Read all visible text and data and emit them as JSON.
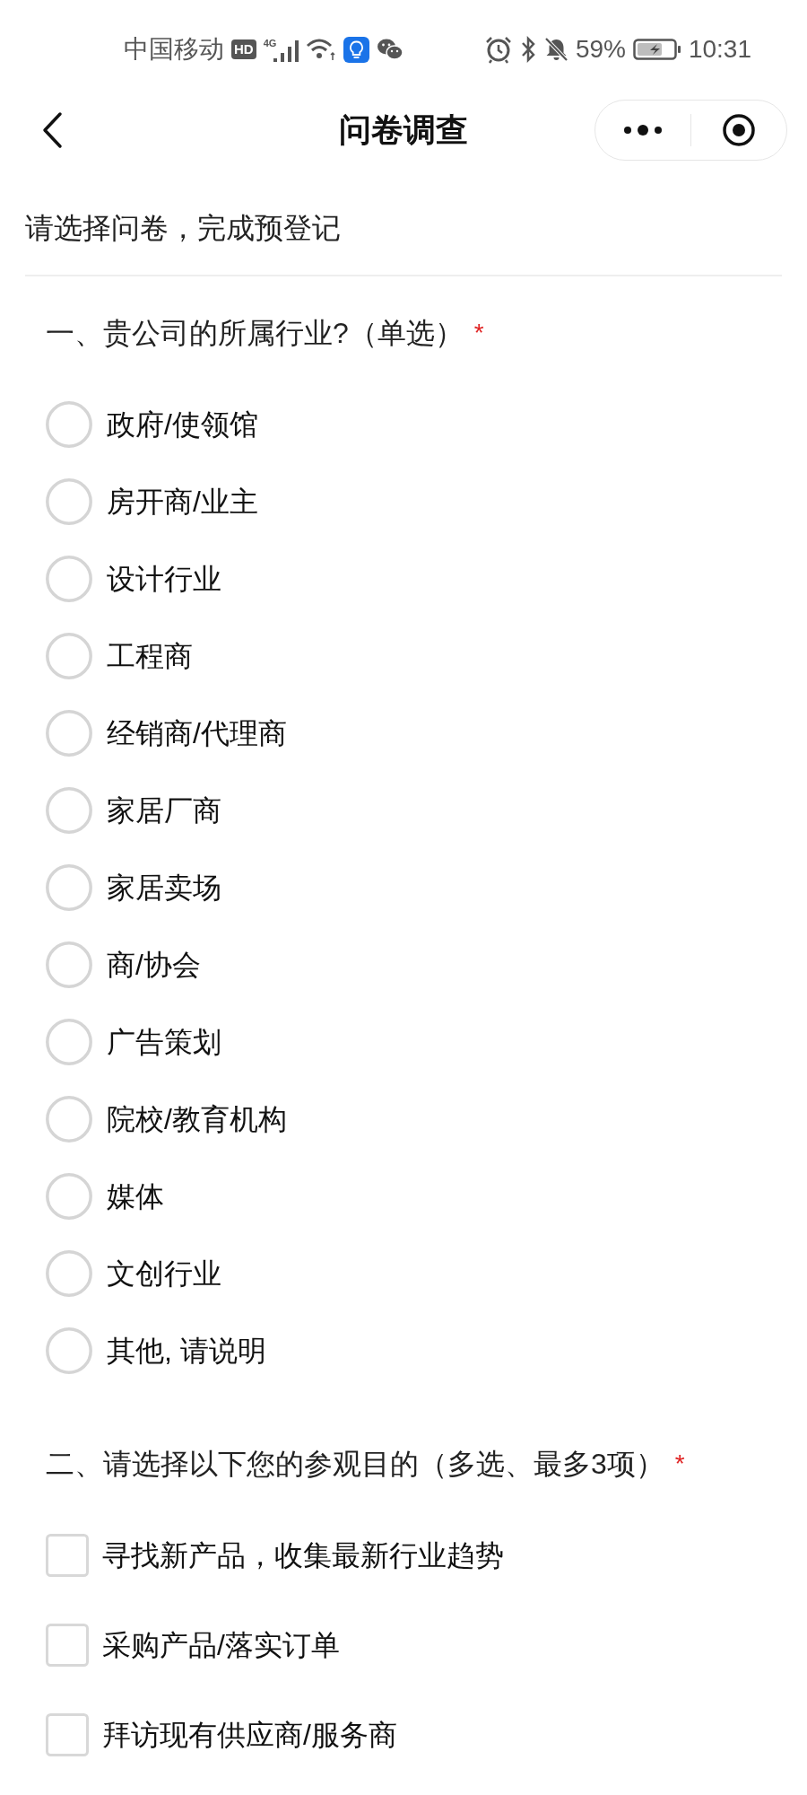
{
  "status_bar": {
    "carrier": "中国移动",
    "hd_badge": "HD",
    "network": "4G",
    "battery_percent": "59%",
    "time": "10:31"
  },
  "header": {
    "title": "问卷调查"
  },
  "intro": "请选择问卷，完成预登记",
  "questions": [
    {
      "kind": "single",
      "title": "一、贵公司的所属行业?（单选）",
      "required_mark": "*",
      "options": [
        {
          "label": "政府/使领馆",
          "selected": false
        },
        {
          "label": "房开商/业主",
          "selected": false
        },
        {
          "label": "设计行业",
          "selected": false
        },
        {
          "label": "工程商",
          "selected": false
        },
        {
          "label": "经销商/代理商",
          "selected": false
        },
        {
          "label": "家居厂商",
          "selected": false
        },
        {
          "label": "家居卖场",
          "selected": false
        },
        {
          "label": "商/协会",
          "selected": false
        },
        {
          "label": "广告策划",
          "selected": false
        },
        {
          "label": "院校/教育机构",
          "selected": false
        },
        {
          "label": "媒体",
          "selected": false
        },
        {
          "label": "文创行业",
          "selected": false
        },
        {
          "label": "其他, 请说明",
          "selected": false
        }
      ]
    },
    {
      "kind": "multiple",
      "title": "二、请选择以下您的参观目的（多选、最多3项）",
      "required_mark": "*",
      "options": [
        {
          "label": "寻找新产品，收集最新行业趋势",
          "checked": false
        },
        {
          "label": "采购产品/落实订单",
          "checked": false
        },
        {
          "label": "拜访现有供应商/服务商",
          "checked": false
        }
      ]
    }
  ]
}
